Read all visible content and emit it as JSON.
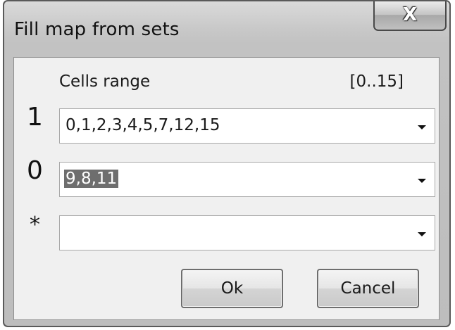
{
  "window": {
    "title": "Fill map from sets",
    "close_icon": "close-icon",
    "close_glyph": "X"
  },
  "header": {
    "range_label": "Cells range",
    "range_value": "[0..15]"
  },
  "rows": [
    {
      "label": "1",
      "value": "0,1,2,3,4,5,7,12,15",
      "selected": false
    },
    {
      "label": "0",
      "value": "9,8,11",
      "selected": true
    },
    {
      "label": "*",
      "value": "",
      "selected": false
    }
  ],
  "buttons": {
    "ok_label": "Ok",
    "cancel_label": "Cancel"
  }
}
